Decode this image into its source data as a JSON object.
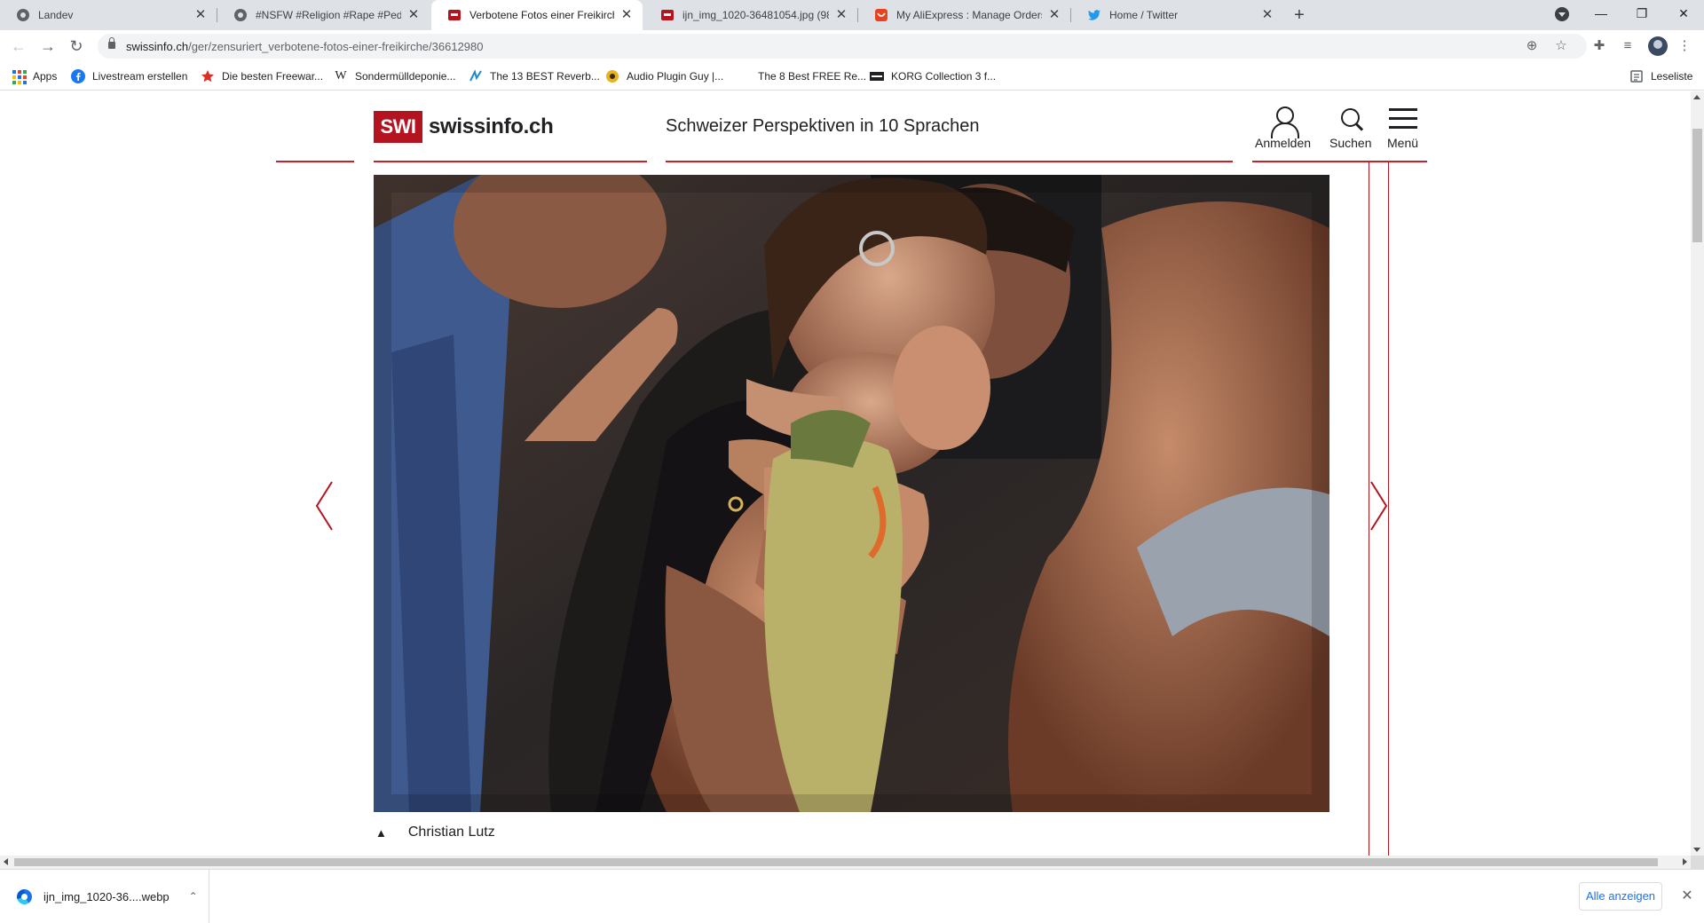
{
  "browser": {
    "tabs": [
      {
        "title": "Landev",
        "active": false
      },
      {
        "title": "#NSFW #Religion #Rape #Pedo #",
        "active": false
      },
      {
        "title": "Verbotene Fotos einer Freikirche",
        "active": true
      },
      {
        "title": "ijn_img_1020-36481054.jpg (980",
        "active": false
      },
      {
        "title": "My AliExpress : Manage Orders",
        "active": false
      },
      {
        "title": "Home / Twitter",
        "active": false
      }
    ],
    "url_host": "swissinfo.ch",
    "url_path": "/ger/zensuriert_verbotene-fotos-einer-freikirche/36612980",
    "bookmarks": [
      {
        "label": "Apps"
      },
      {
        "label": "Livestream erstellen"
      },
      {
        "label": "Die besten Freewar..."
      },
      {
        "label": "Sondermülldeponie..."
      },
      {
        "label": "The 13 BEST Reverb..."
      },
      {
        "label": "Audio Plugin Guy |..."
      },
      {
        "label": "The 8 Best FREE Re..."
      },
      {
        "label": "KORG Collection 3 f..."
      }
    ],
    "reading_list": "Leseliste",
    "colors": {
      "tab_strip": "#dee1e6",
      "accent": "#1a73e8"
    }
  },
  "site": {
    "logo_box": "SWI",
    "logo_name": "swissinfo.ch",
    "tagline": "Schweizer Perspektiven in 10 Sprachen",
    "actions": {
      "login": "Anmelden",
      "search": "Suchen",
      "menu": "Menü"
    },
    "brand_color": "#b3141f"
  },
  "gallery": {
    "photo_credit": "Christian Lutz",
    "caption_marker": "▲",
    "prev_label": "previous-image",
    "next_label": "next-image"
  },
  "downloads": {
    "file_name": "ijn_img_1020-36....webp",
    "show_all": "Alle anzeigen"
  }
}
